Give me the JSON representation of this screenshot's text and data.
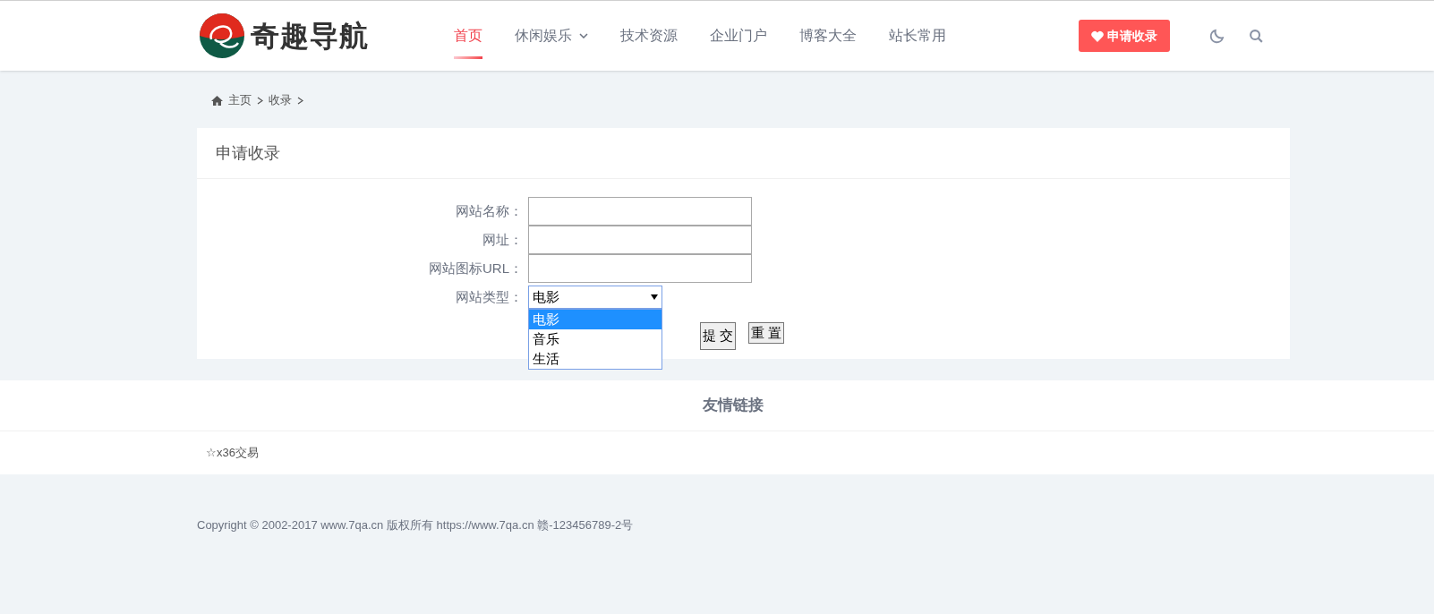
{
  "header": {
    "logo_text": "奇趣导航",
    "nav": [
      {
        "label": "首页",
        "selected": true,
        "has_menu": false
      },
      {
        "label": "休闲娱乐",
        "selected": false,
        "has_menu": true
      },
      {
        "label": "技术资源",
        "selected": false,
        "has_menu": false
      },
      {
        "label": "企业门户",
        "selected": false,
        "has_menu": false
      },
      {
        "label": "博客大全",
        "selected": false,
        "has_menu": false
      },
      {
        "label": "站长常用",
        "selected": false,
        "has_menu": false
      }
    ],
    "apply_button": "申请收录"
  },
  "breadcrumb": [
    "主页",
    "收录"
  ],
  "form_card": {
    "title": "申请收录",
    "fields": [
      {
        "kind": "text",
        "label": "网站名称："
      },
      {
        "kind": "text",
        "label": "网址："
      },
      {
        "kind": "text",
        "label": "网站图标URL："
      },
      {
        "kind": "select",
        "label": "网站类型：",
        "value": "电影",
        "expanded": true,
        "options": [
          {
            "label": "电影",
            "selected": true
          },
          {
            "label": "音乐",
            "selected": false
          },
          {
            "label": "生活",
            "selected": false
          }
        ]
      }
    ],
    "buttons": [
      "提 交",
      "重 置"
    ]
  },
  "links_section": {
    "title": "友情链接",
    "links": [
      "☆x36交易"
    ]
  },
  "copyright": "Copyright © 2002-2017 www.7qa.cn 版权所有 https://www.7qa.cn 赣-123456789-2号"
}
